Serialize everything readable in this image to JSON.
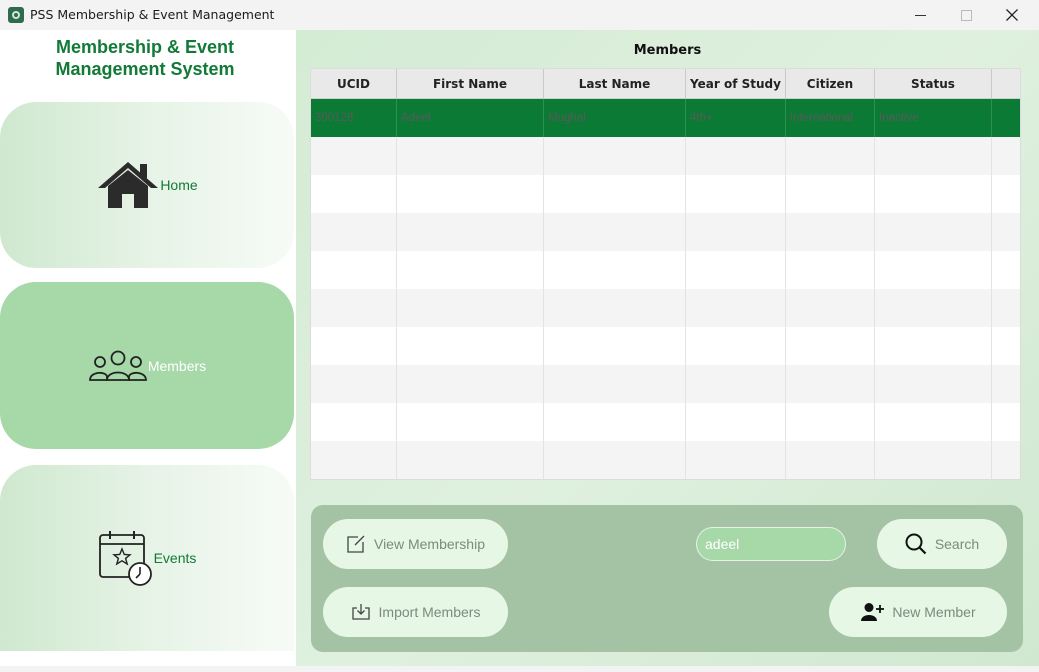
{
  "window": {
    "title": "PSS Membership & Event Management",
    "min_glyph": "—",
    "max_glyph": "☐",
    "close_glyph": "✕"
  },
  "sidebar": {
    "title_line1": "Membership & Event",
    "title_line2": "Management System",
    "items": [
      {
        "label": "Home",
        "icon": "home-icon",
        "active": false
      },
      {
        "label": "Members",
        "icon": "members-icon",
        "active": true
      },
      {
        "label": "Events",
        "icon": "calendar-clock-icon",
        "active": false
      }
    ]
  },
  "main": {
    "title": "Members",
    "table": {
      "columns": [
        "UCID",
        "First Name",
        "Last Name",
        "Year of Study",
        "Citizen",
        "Status"
      ],
      "rows": [
        [
          "300128",
          "Adeel",
          "Mughal",
          "4th+",
          "International",
          "Inactive"
        ]
      ],
      "selected_row": 0
    },
    "actions": {
      "view_membership": "View Membership",
      "import_members": "Import Members",
      "search_value": "adeel",
      "search": "Search",
      "new_member": "New Member"
    }
  },
  "colors": {
    "brand_green": "#117a36",
    "selected_row": "#0b7a34",
    "active_nav": "#a6d8a8",
    "action_panel": "#a3c3a4",
    "button_bg": "#e6f7e6"
  }
}
